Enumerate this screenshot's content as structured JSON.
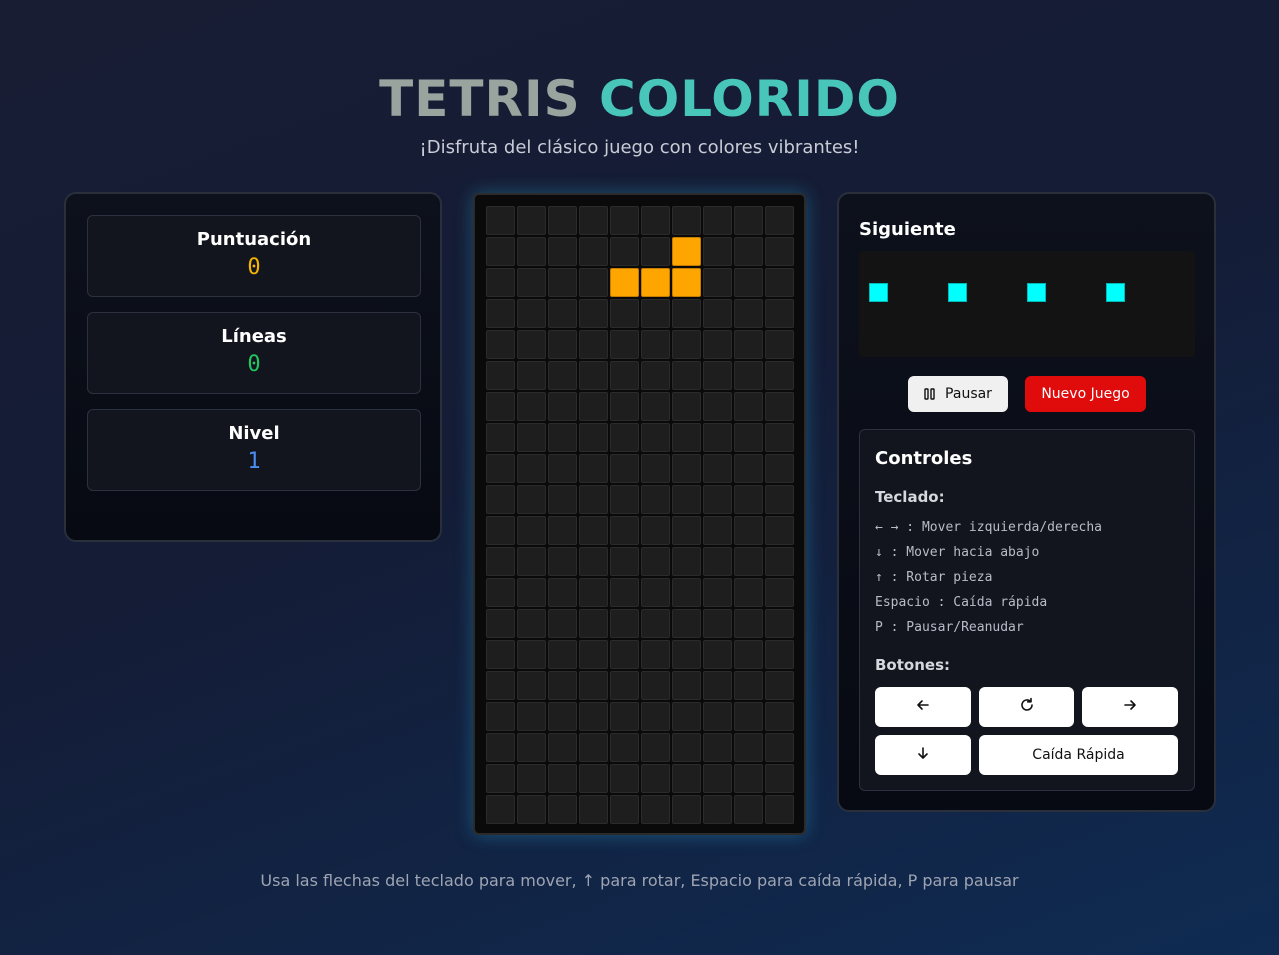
{
  "header": {
    "title_part1": "TETRIS",
    "title_part2": "COLORIDO",
    "subtitle": "¡Disfruta del clásico juego con colores vibrantes!"
  },
  "stats": {
    "score": {
      "label": "Puntuación",
      "value": "0",
      "color": "#f5b400"
    },
    "lines": {
      "label": "Líneas",
      "value": "0",
      "color": "#22c55e"
    },
    "level": {
      "label": "Nivel",
      "value": "1",
      "color": "#4a8df0"
    }
  },
  "board": {
    "columns": 10,
    "rows": 20,
    "active_piece": {
      "type": "L",
      "color": "#ffa500",
      "cells": [
        [
          1,
          6
        ],
        [
          2,
          4
        ],
        [
          2,
          5
        ],
        [
          2,
          6
        ]
      ]
    }
  },
  "next_piece": {
    "label": "Siguiente",
    "type": "I",
    "color": "#00ffff",
    "block_count": 4
  },
  "actions": {
    "pause_label": "Pausar",
    "pause_icon": "pause-icon",
    "new_game_label": "Nuevo Juego"
  },
  "controls": {
    "title": "Controles",
    "keyboard_heading": "Teclado:",
    "keyboard_lines": [
      "← → : Mover izquierda/derecha",
      "↓ : Mover hacia abajo",
      "↑ : Rotar pieza",
      "Espacio : Caída rápida",
      "P : Pausar/Reanudar"
    ],
    "buttons_heading": "Botones:",
    "buttons": {
      "left_icon": "arrow-left-icon",
      "rotate_icon": "rotate-icon",
      "right_icon": "arrow-right-icon",
      "down_icon": "arrow-down-icon",
      "hard_drop_label": "Caída Rápida"
    }
  },
  "footer": {
    "text": "Usa las flechas del teclado para mover, ↑ para rotar, Espacio para caída rápida, P para pausar"
  }
}
